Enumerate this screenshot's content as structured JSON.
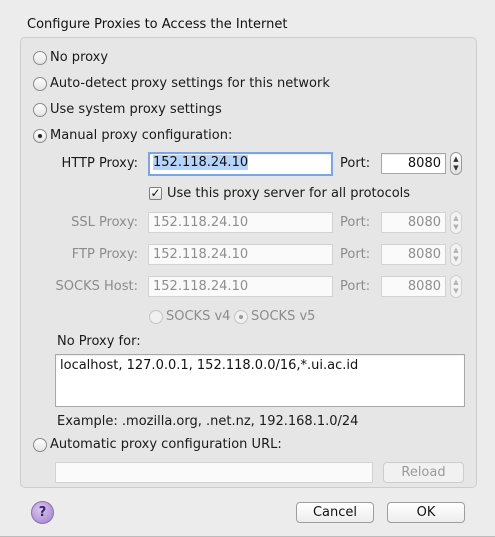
{
  "heading": "Configure Proxies to Access the Internet",
  "options": {
    "no_proxy": "No proxy",
    "auto_detect": "Auto-detect proxy settings for this network",
    "system": "Use system proxy settings",
    "manual": "Manual proxy configuration:",
    "auto_url": "Automatic proxy configuration URL:"
  },
  "selected_option": "manual",
  "http": {
    "label": "HTTP Proxy:",
    "value": "152.118.24.10",
    "port_label": "Port:",
    "port": "8080"
  },
  "use_for_all": {
    "label": "Use this proxy server for all protocols",
    "checked": true
  },
  "ssl": {
    "label": "SSL Proxy:",
    "value": "152.118.24.10",
    "port_label": "Port:",
    "port": "8080"
  },
  "ftp": {
    "label": "FTP Proxy:",
    "value": "152.118.24.10",
    "port_label": "Port:",
    "port": "8080"
  },
  "socks": {
    "label": "SOCKS Host:",
    "value": "152.118.24.10",
    "port_label": "Port:",
    "port": "8080"
  },
  "socks_version": {
    "v4": "SOCKS v4",
    "v5": "SOCKS v5",
    "selected": "v5"
  },
  "no_proxy_for": {
    "label": "No Proxy for:",
    "value": "localhost, 127.0.0.1, 152.118.0.0/16,*.ui.ac.id",
    "example": "Example: .mozilla.org, .net.nz, 192.168.1.0/24"
  },
  "auto_url": {
    "value": "",
    "reload_label": "Reload"
  },
  "buttons": {
    "help": "?",
    "cancel": "Cancel",
    "ok": "OK"
  },
  "icons": {
    "help": "help-icon",
    "stepper": "stepper-arrows-icon",
    "check": "checkmark-icon"
  }
}
